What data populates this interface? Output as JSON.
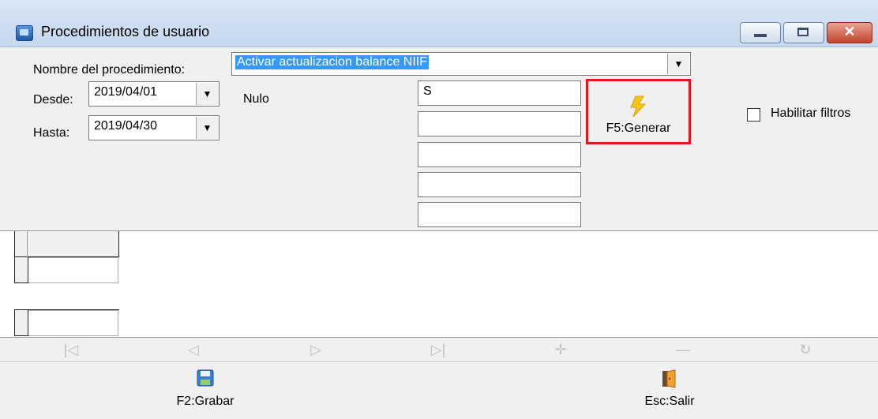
{
  "window": {
    "title": "Procedimientos de usuario",
    "close_glyph": "✕"
  },
  "form": {
    "procedure_label": "Nombre del procedimiento:",
    "procedure_value": "Activar actualizacion balance NIIF",
    "desde_label": "Desde:",
    "desde_value": "2019/04/01",
    "hasta_label": "Hasta:",
    "hasta_value": "2019/04/30",
    "nulo_label": "Nulo",
    "params": [
      "S",
      "",
      "",
      "",
      ""
    ],
    "dropdown_glyph": "▼",
    "enable_filters_label": "Habilitar filtros",
    "enable_filters_checked": false
  },
  "generate_button": {
    "label": "F5:Generar",
    "icon": "lightning-icon",
    "highlight_color": "#e8141c"
  },
  "navigator": {
    "buttons": [
      {
        "icon": "first-icon",
        "glyph": "|◁"
      },
      {
        "icon": "prior-icon",
        "glyph": "◁"
      },
      {
        "icon": "next-icon",
        "glyph": "▷"
      },
      {
        "icon": "last-icon",
        "glyph": "▷|"
      },
      {
        "icon": "insert-icon",
        "glyph": "✛"
      },
      {
        "icon": "delete-icon",
        "glyph": "—"
      },
      {
        "icon": "refresh-icon",
        "glyph": "↻"
      }
    ]
  },
  "footer": {
    "save_label": "F2:Grabar",
    "save_icon": "floppy-disk-icon",
    "exit_label": "Esc:Salir",
    "exit_icon": "door-exit-icon"
  }
}
